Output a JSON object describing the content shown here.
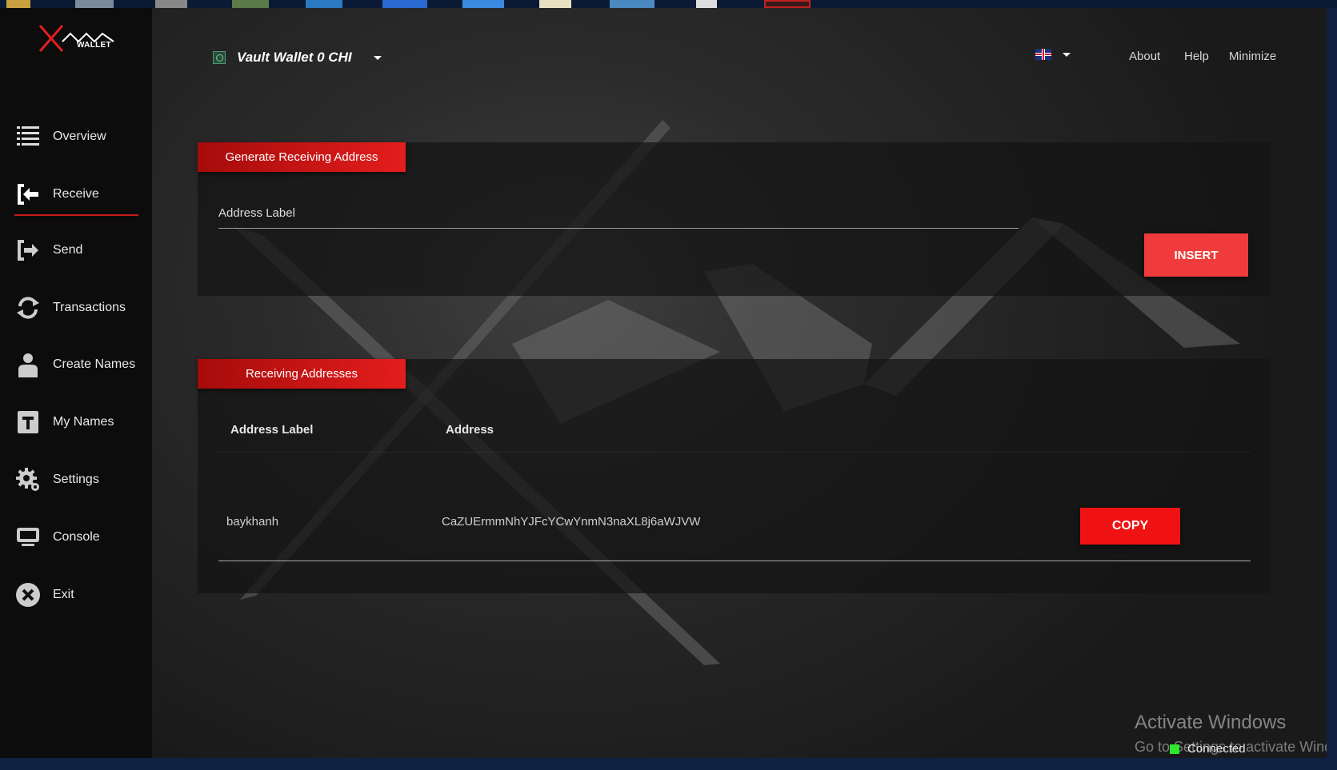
{
  "app": {
    "logo_text": "WALLET",
    "wallet_selector": "Vault Wallet 0 CHI",
    "language": "English (UK)"
  },
  "sidebar": {
    "items": [
      {
        "label": "Overview",
        "icon": "list-icon"
      },
      {
        "label": "Receive",
        "icon": "receive-icon",
        "active": true
      },
      {
        "label": "Send",
        "icon": "send-icon"
      },
      {
        "label": "Transactions",
        "icon": "sync-icon"
      },
      {
        "label": "Create Names",
        "icon": "user-icon"
      },
      {
        "label": "My Names",
        "icon": "names-icon"
      },
      {
        "label": "Settings",
        "icon": "gear-icon"
      },
      {
        "label": "Console",
        "icon": "monitor-icon"
      },
      {
        "label": "Exit",
        "icon": "close-icon"
      }
    ]
  },
  "header": {
    "links": [
      "About",
      "Help",
      "Minimize"
    ]
  },
  "generate": {
    "title": "Generate Receiving Address",
    "input_placeholder": "Address Label",
    "insert_label": "INSERT"
  },
  "receiving": {
    "title": "Receiving Addresses",
    "columns": [
      "Address Label",
      "Address"
    ],
    "rows": [
      {
        "label": "baykhanh",
        "address": "CaZUErmmNhYJFcYCwYnmN3naXL8j6aWJVW",
        "copy_label": "COPY"
      }
    ]
  },
  "watermark": {
    "line1": "Activate Windows",
    "line2": "Go to Settings to activate Windows."
  },
  "status": {
    "text": "Connected",
    "color": "#2ee82e"
  },
  "colors": {
    "accent": "#e51d1d",
    "button": "#ef3b3b",
    "sidebar": "#0c0c0c"
  }
}
